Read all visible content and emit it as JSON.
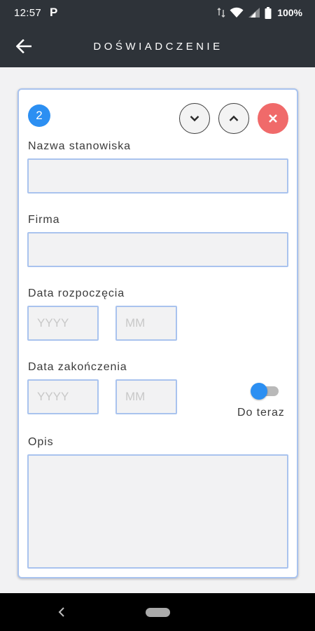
{
  "status_bar": {
    "time": "12:57",
    "app_icon": "P",
    "battery": "100%"
  },
  "app_bar": {
    "title": "DOŚWIADCZENIE",
    "back_icon": "arrow-left-icon"
  },
  "card": {
    "index": "2",
    "buttons": {
      "move_down_icon": "chevron-down-icon",
      "move_up_icon": "chevron-up-icon",
      "remove_icon": "close-icon"
    },
    "fields": {
      "position_label": "Nazwa stanowiska",
      "position_value": "",
      "company_label": "Firma",
      "company_value": "",
      "start_label": "Data rozpoczęcia",
      "start_year_placeholder": "YYYY",
      "start_month_placeholder": "MM",
      "end_label": "Data zakończenia",
      "end_year_placeholder": "YYYY",
      "end_month_placeholder": "MM",
      "until_now_label": "Do teraz",
      "until_now_on": true,
      "description_label": "Opis",
      "description_value": ""
    }
  },
  "colors": {
    "bar": "#2e3339",
    "accent": "#2c8ff2",
    "remove": "#f06a6a",
    "input_border": "#a9c3ee"
  }
}
